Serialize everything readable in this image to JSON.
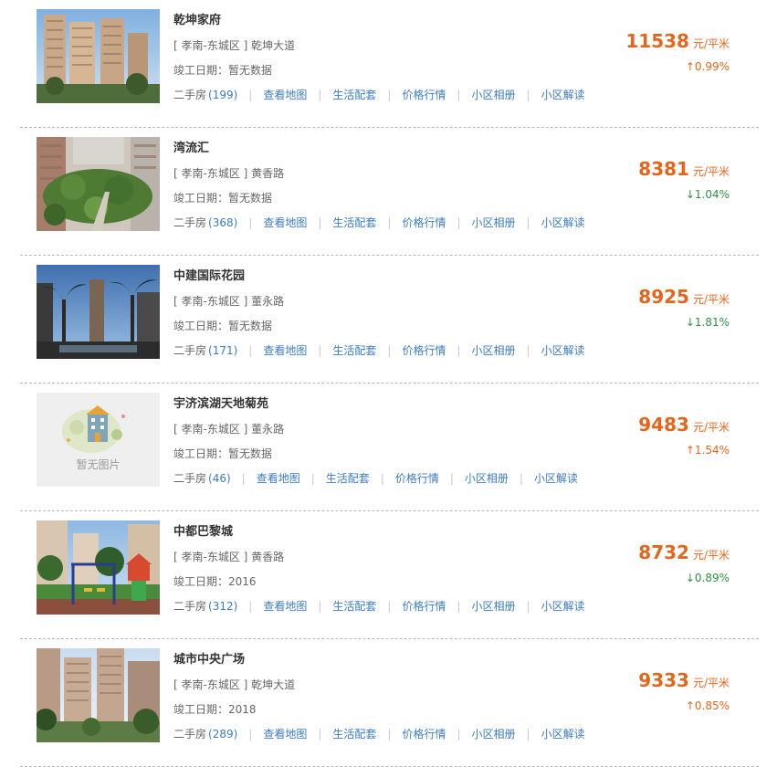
{
  "colors": {
    "price": "#e7651a",
    "up": "#e7651a",
    "down": "#2e9040",
    "link": "#3b7cc4"
  },
  "link_labels": {
    "resale_label": "二手房",
    "map": "查看地图",
    "life": "生活配套",
    "price_trend": "价格行情",
    "album": "小区相册",
    "interpret": "小区解读"
  },
  "price_unit": "元/平米",
  "no_photo_text": "暂无图片",
  "listings": [
    {
      "name": "乾坤家府",
      "district": "[ 孝南-东城区 ]",
      "road": "乾坤大道",
      "completion": "竣工日期：暂无数据",
      "resale_count": "(199)",
      "price": "11538",
      "change": "↑0.99%",
      "direction": "up",
      "image_icon": "tall-towers-photo"
    },
    {
      "name": "湾流汇",
      "district": "[ 孝南-东城区 ]",
      "road": "黄香路",
      "completion": "竣工日期：暂无数据",
      "resale_count": "(368)",
      "price": "8381",
      "change": "↓1.04%",
      "direction": "down",
      "image_icon": "courtyard-garden-photo"
    },
    {
      "name": "中建国际花园",
      "district": "[ 孝南-东城区 ]",
      "road": "董永路",
      "completion": "竣工日期：暂无数据",
      "resale_count": "(171)",
      "price": "8925",
      "change": "↓1.81%",
      "direction": "down",
      "image_icon": "palm-pool-photo"
    },
    {
      "name": "宇济滨湖天地菊苑",
      "district": "[ 孝南-东城区 ]",
      "road": "董永路",
      "completion": "竣工日期：暂无数据",
      "resale_count": "(46)",
      "price": "9483",
      "change": "↑1.54%",
      "direction": "up",
      "image_icon": "no-photo-placeholder"
    },
    {
      "name": "中都巴黎城",
      "district": "[ 孝南-东城区 ]",
      "road": "黄香路",
      "completion": "竣工日期：2016",
      "resale_count": "(312)",
      "price": "8732",
      "change": "↓0.89%",
      "direction": "down",
      "image_icon": "playground-photo"
    },
    {
      "name": "城市中央广场",
      "district": "[ 孝南-东城区 ]",
      "road": "乾坤大道",
      "completion": "竣工日期：2018",
      "resale_count": "(289)",
      "price": "9333",
      "change": "↑0.85%",
      "direction": "up",
      "image_icon": "street-towers-photo"
    }
  ]
}
